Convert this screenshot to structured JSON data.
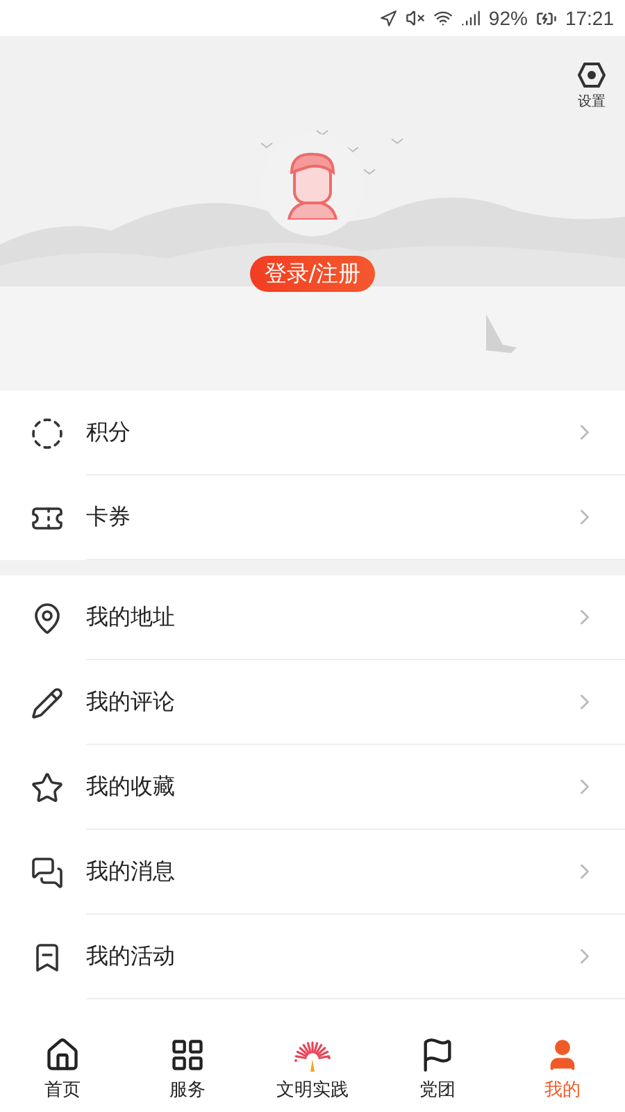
{
  "status_bar": {
    "battery": "92%",
    "time": "17:21"
  },
  "header": {
    "settings_label": "设置",
    "login_button": "登录/注册"
  },
  "menu_groups": [
    {
      "items": [
        {
          "label": "积分"
        },
        {
          "label": "卡券"
        }
      ]
    },
    {
      "items": [
        {
          "label": "我的地址"
        },
        {
          "label": "我的评论"
        },
        {
          "label": "我的收藏"
        },
        {
          "label": "我的消息"
        },
        {
          "label": "我的活动"
        }
      ]
    }
  ],
  "bottom_nav": [
    {
      "label": "首页",
      "selected": false
    },
    {
      "label": "服务",
      "selected": false
    },
    {
      "label": "文明实践",
      "selected": false
    },
    {
      "label": "党团",
      "selected": false
    },
    {
      "label": "我的",
      "selected": true
    }
  ]
}
